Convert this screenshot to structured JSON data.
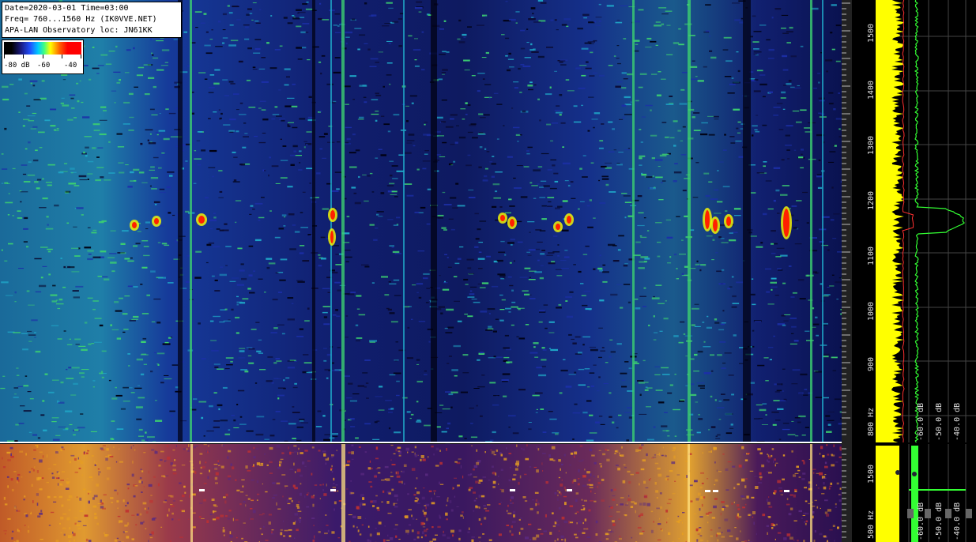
{
  "header": {
    "line1": "Date=2020-03-01 Time=03:00",
    "line2": "Freq= 760...1560 Hz (IK0VVE.NET)",
    "line3": "APA-LAN Observatory loc: JN61KK"
  },
  "colorbar": {
    "labels": [
      "-80 dB",
      "-60",
      "-40"
    ]
  },
  "freq_axis_top": {
    "ticks": [
      "1500",
      "1400",
      "1300",
      "1200",
      "1100",
      "1000",
      "900",
      "800 Hz"
    ]
  },
  "freq_axis_bottom": {
    "ticks": [
      "1500",
      "500 Hz"
    ]
  },
  "spectrum_axis_top": {
    "ticks": [
      "-60.0 dB",
      "-50.0 dB",
      "-40.0 dB"
    ]
  },
  "spectrum_axis_bottom": {
    "ticks": [
      "-60.0 dB",
      "-50.0 dB",
      "-40.0 dB"
    ]
  },
  "colors": {
    "waterfall_bg": "#0a0f3a",
    "waterfall_low": "#1c2fa8",
    "waterfall_mid": "#1fa8c8",
    "waterfall_hi": "#3cd070",
    "spot": "#ff2000",
    "spectrum_yellow": "#ffff00",
    "spectrum_green": "#33ff33",
    "spectrum_red": "#ff3030",
    "lower_bg": "#3a1560",
    "lower_warm": "#e8a020"
  }
}
